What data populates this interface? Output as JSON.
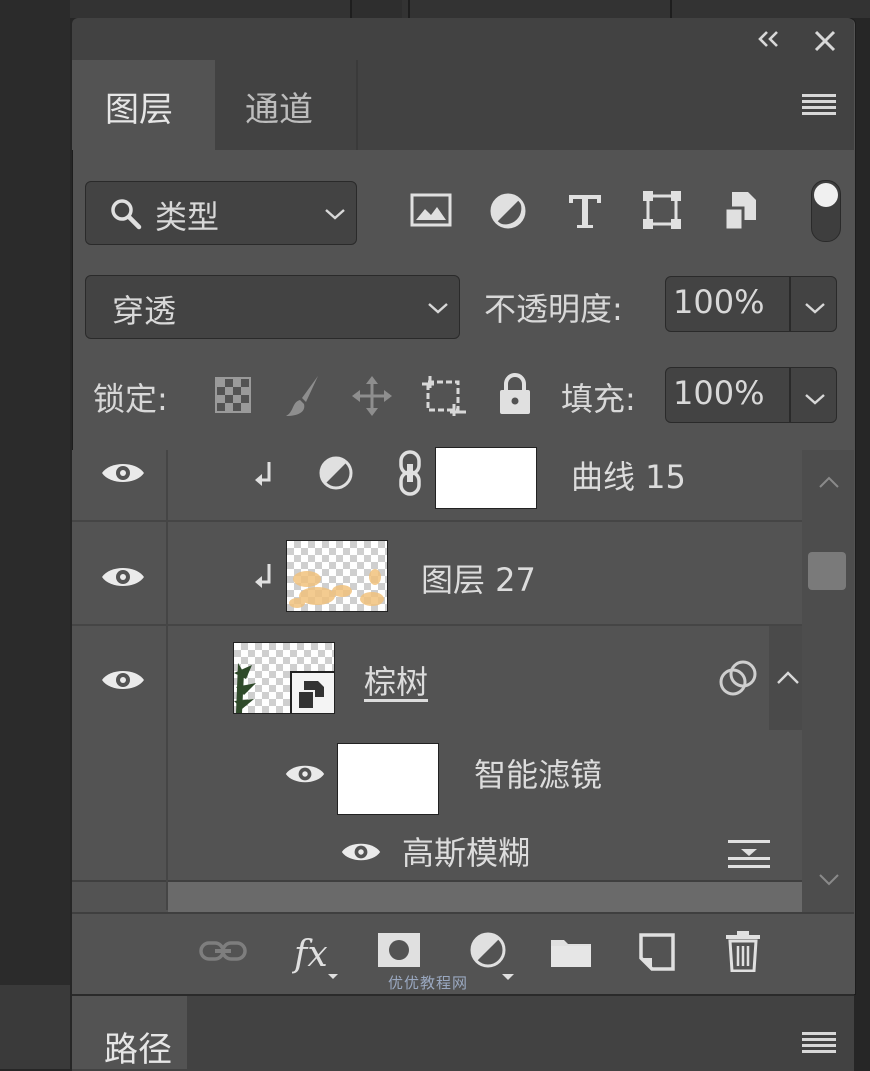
{
  "tabs": [
    {
      "label": "图层",
      "active": true
    },
    {
      "label": "通道",
      "active": false
    }
  ],
  "filter": {
    "kind_label": "类型",
    "icons": [
      "image-filter-icon",
      "adjustment-filter-icon",
      "type-filter-icon",
      "shape-filter-icon",
      "smart-object-filter-icon"
    ]
  },
  "blend": {
    "mode": "穿透",
    "opacity_label": "不透明度:",
    "opacity_value": "100%"
  },
  "lock": {
    "label": "锁定:",
    "fill_label": "填充:",
    "fill_value": "100%"
  },
  "layers": [
    {
      "name": "曲线 15",
      "type": "adjustment",
      "clipped": true
    },
    {
      "name": "图层 27",
      "type": "pixel",
      "clipped": true
    },
    {
      "name": "棕树",
      "type": "smart-object"
    },
    {
      "name": "智能滤镜",
      "type": "smart-filter-mask"
    },
    {
      "name": "高斯模糊",
      "type": "filter"
    }
  ],
  "bottom_panel": {
    "tab": "路径"
  },
  "watermark": "优优教程网",
  "colors": {
    "panel": "#535353",
    "header": "#424242",
    "field": "#434343",
    "text": "#d8d8d8"
  }
}
